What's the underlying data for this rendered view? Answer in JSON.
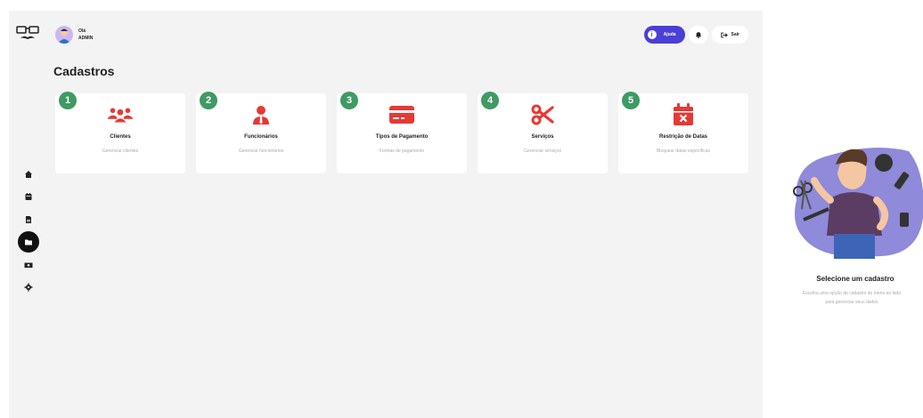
{
  "user": {
    "greeting": "Olá",
    "role": "ADMIN"
  },
  "header": {
    "help_label": "Ajuda",
    "logout_label": "Sair"
  },
  "page": {
    "title": "Cadastros"
  },
  "sidebar": {
    "items": [
      {
        "icon": "home-icon"
      },
      {
        "icon": "calendar-icon"
      },
      {
        "icon": "document-icon"
      },
      {
        "icon": "folder-icon",
        "active": true
      },
      {
        "icon": "money-icon"
      },
      {
        "icon": "gear-icon"
      }
    ]
  },
  "cards": [
    {
      "number": "1",
      "title": "Clientes",
      "subtitle": "Gerenciar clientes",
      "icon": "users-icon"
    },
    {
      "number": "2",
      "title": "Funcionários",
      "subtitle": "Gerenciar funcionários",
      "icon": "employee-icon"
    },
    {
      "number": "3",
      "title": "Tipos de Pagamento",
      "subtitle": "Formas de pagamento",
      "icon": "credit-card-icon"
    },
    {
      "number": "4",
      "title": "Serviços",
      "subtitle": "Gerenciar serviços",
      "icon": "scissors-icon"
    },
    {
      "number": "5",
      "title": "Restrição de Datas",
      "subtitle": "Bloquear datas específicas",
      "icon": "calendar-x-icon"
    }
  ],
  "right_panel": {
    "title": "Selecione um cadastro",
    "line1": "Escolha uma opção de cadastro do menu ao lado",
    "line2": "para gerenciar seus dados"
  },
  "colors": {
    "accent": "#4a3fd6",
    "icon_red": "#e53935",
    "badge_green": "#3f9a63",
    "illustration_bg": "#8f8ad9"
  }
}
